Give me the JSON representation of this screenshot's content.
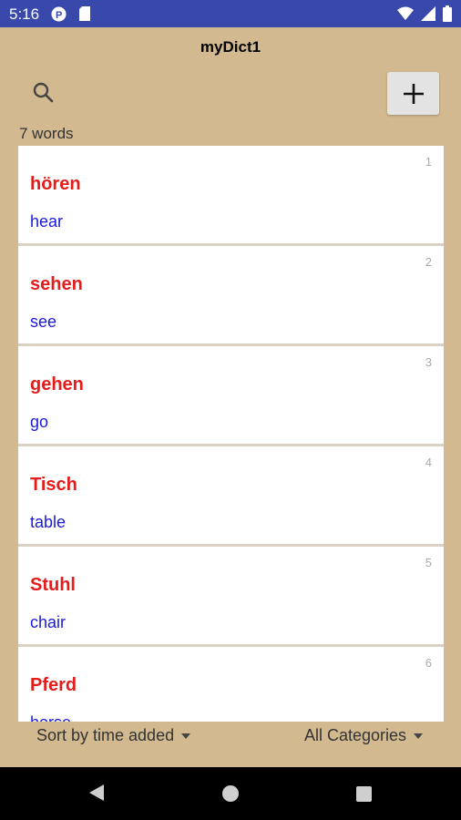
{
  "status_bar": {
    "time": "5:16",
    "icons": [
      "notification-p-icon",
      "sd-card-icon",
      "wifi-icon",
      "signal-icon",
      "battery-icon"
    ]
  },
  "app": {
    "title": "myDict1",
    "word_count": "7 words"
  },
  "words": [
    {
      "index": "1",
      "term": "hören",
      "meaning": "hear"
    },
    {
      "index": "2",
      "term": "sehen",
      "meaning": "see"
    },
    {
      "index": "3",
      "term": "gehen",
      "meaning": "go"
    },
    {
      "index": "4",
      "term": "Tisch",
      "meaning": "table"
    },
    {
      "index": "5",
      "term": "Stuhl",
      "meaning": "chair"
    },
    {
      "index": "6",
      "term": "Pferd",
      "meaning": "horse"
    }
  ],
  "footer": {
    "sort_label": "Sort by time added",
    "category_label": "All Categories"
  },
  "colors": {
    "background": "#d3b98f",
    "status_bar": "#3949ab",
    "term": "#e51c1c",
    "meaning": "#1a1adb"
  }
}
